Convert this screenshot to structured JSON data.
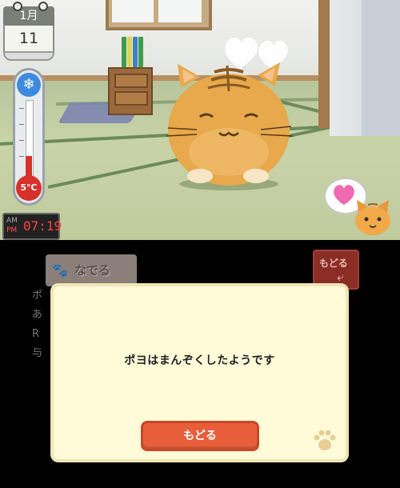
{
  "top_screen": {
    "calendar": {
      "month": "1月",
      "day": "11"
    },
    "thermometer": {
      "temperature_label": "5℃",
      "icon": "snowflake-icon"
    },
    "clock": {
      "am": "AM",
      "pm": "PM",
      "time": "07:19"
    }
  },
  "bottom_screen": {
    "action_tab": {
      "label": "なでる"
    },
    "corner_back": {
      "label": "もどる"
    },
    "side_text": [
      "ポ",
      "あ",
      "R",
      "与"
    ],
    "dialog": {
      "message": "ポヨはまんぞくしたようです",
      "button_label": "もどる"
    }
  },
  "colors": {
    "button": "#e95e3a",
    "dialog_bg": "#fffbd9",
    "cat": "#e7a94b"
  }
}
